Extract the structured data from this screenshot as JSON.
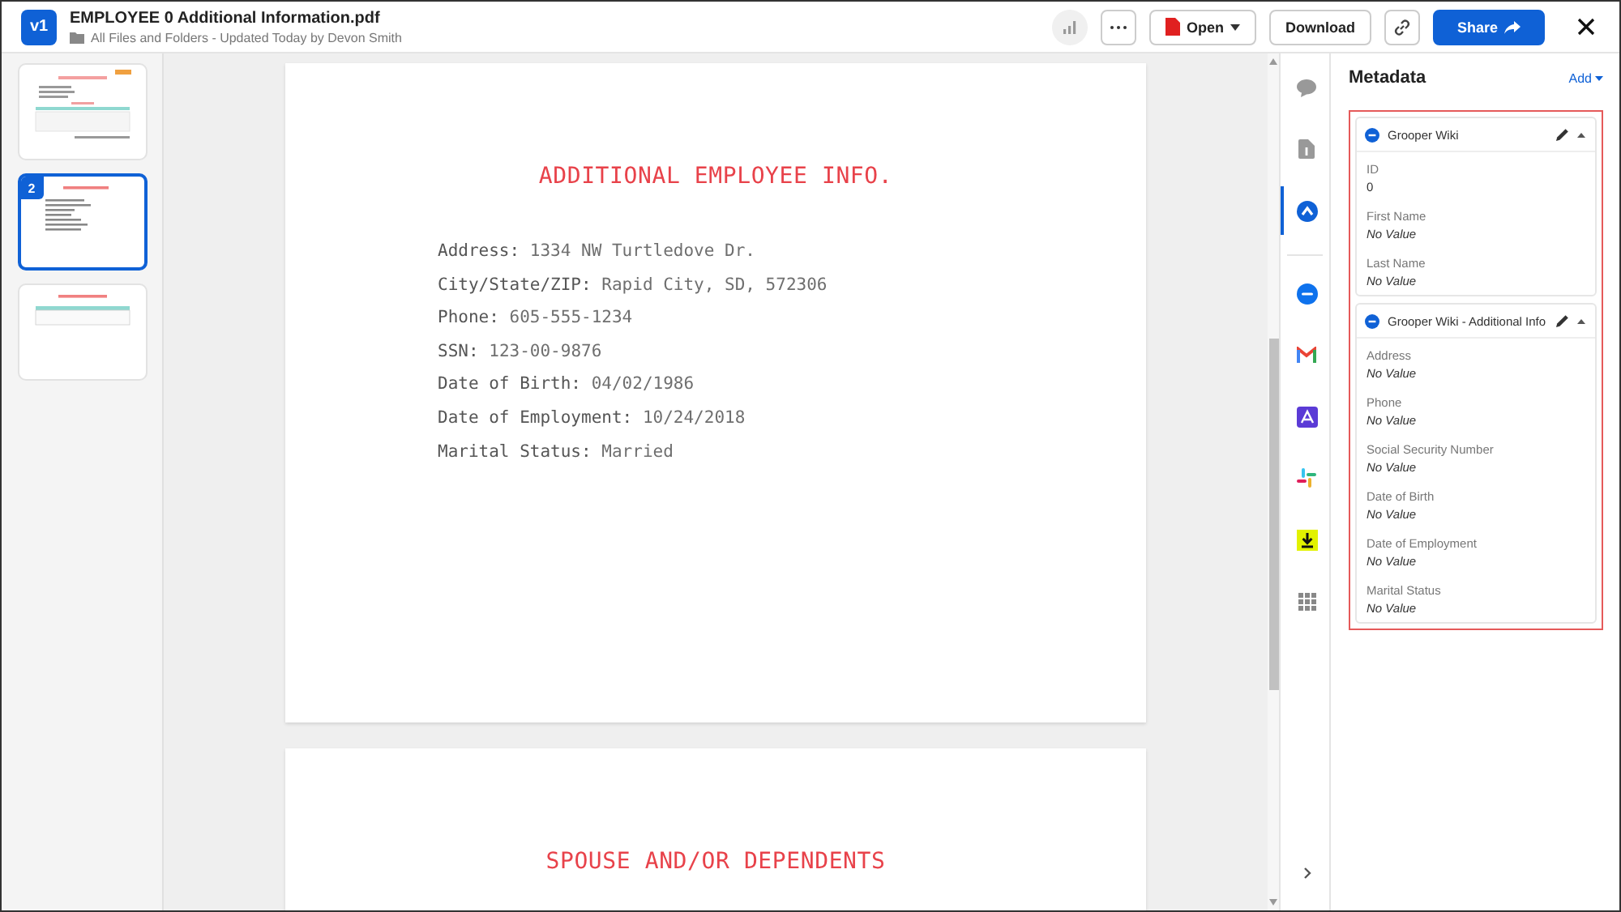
{
  "header": {
    "version": "v1",
    "title": "EMPLOYEE 0 Additional Information.pdf",
    "breadcrumb": "All Files and Folders - Updated Today by Devon Smith",
    "open": "Open",
    "download": "Download",
    "share": "Share"
  },
  "thumbnails": [
    {
      "kind": "report",
      "selected": false
    },
    {
      "kind": "info",
      "selected": true,
      "number": "2"
    },
    {
      "kind": "table",
      "selected": false
    }
  ],
  "pages": [
    {
      "title": "ADDITIONAL EMPLOYEE INFO.",
      "fields": [
        {
          "label": "Address:",
          "value": "1334 NW Turtledove Dr."
        },
        {
          "label": "City/State/ZIP:",
          "value": "Rapid City, SD, 572306"
        },
        {
          "label": "Phone:",
          "value": "605-555-1234"
        },
        {
          "label": "SSN:",
          "value": "123-00-9876"
        },
        {
          "label": "Date of Birth:",
          "value": "04/02/1986"
        },
        {
          "label": "Date of Employment:",
          "value": "10/24/2018"
        },
        {
          "label": "Marital Status:",
          "value": "Married"
        }
      ]
    },
    {
      "title": "SPOUSE AND/OR DEPENDENTS"
    }
  ],
  "rail": [
    {
      "kind": "comment",
      "selected": false
    },
    {
      "kind": "document",
      "selected": false
    },
    {
      "kind": "metadata",
      "selected": true
    },
    {
      "kind": "zoom",
      "selected": false
    },
    {
      "kind": "mail",
      "selected": false
    },
    {
      "kind": "pdf",
      "selected": false
    },
    {
      "kind": "slack",
      "selected": false
    },
    {
      "kind": "download",
      "selected": false
    },
    {
      "kind": "apps",
      "selected": false
    }
  ],
  "metadata": {
    "title": "Metadata",
    "add": "Add",
    "cards": [
      {
        "name": "Grooper Wiki",
        "expanded": true,
        "fields": [
          {
            "label": "ID",
            "value": "0",
            "empty": false
          },
          {
            "label": "First Name",
            "value": "No Value",
            "empty": true
          },
          {
            "label": "Last Name",
            "value": "No Value",
            "empty": true
          }
        ]
      },
      {
        "name": "Grooper Wiki - Additional Info",
        "expanded": true,
        "fields": [
          {
            "label": "Address",
            "value": "No Value",
            "empty": true
          },
          {
            "label": "Phone",
            "value": "No Value",
            "empty": true
          },
          {
            "label": "Social Security Number",
            "value": "No Value",
            "empty": true
          },
          {
            "label": "Date of Birth",
            "value": "No Value",
            "empty": true
          },
          {
            "label": "Date of Employment",
            "value": "No Value",
            "empty": true
          },
          {
            "label": "Marital Status",
            "value": "No Value",
            "empty": true
          }
        ]
      }
    ]
  }
}
